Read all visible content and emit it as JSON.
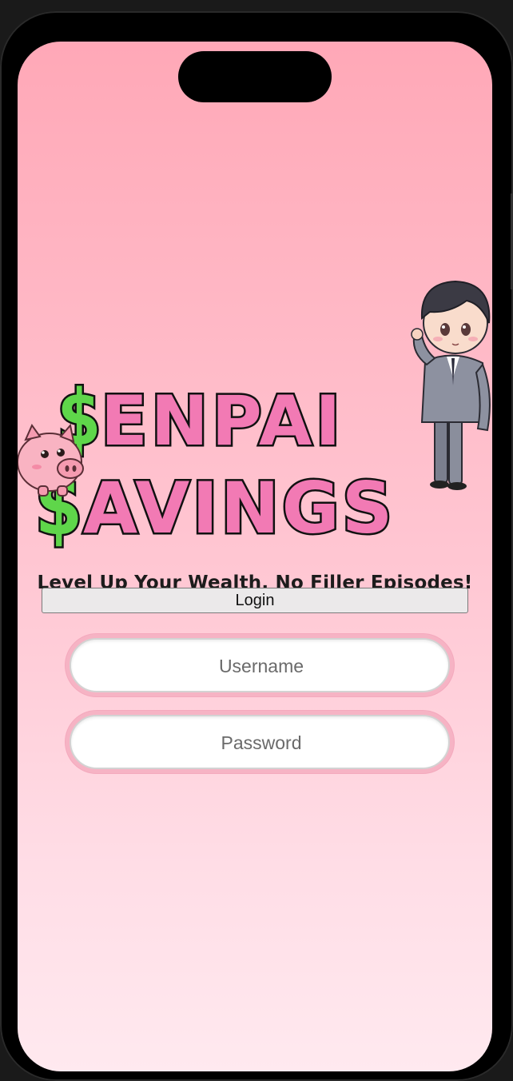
{
  "app": {
    "logo_text_line1": "SENPAI",
    "logo_text_line2": "SAVINGS",
    "tagline": "Level Up Your Wealth, No Filler Episodes!"
  },
  "auth": {
    "login_label": "Login",
    "username_placeholder": "Username",
    "password_placeholder": "Password",
    "username_value": "",
    "password_value": ""
  },
  "icons": {
    "piggy": "piggy-bank-mascot",
    "character": "chibi-businessman-mascot"
  },
  "colors": {
    "brand_pink": "#f27ab4",
    "brand_green": "#5fd64a",
    "bg_top": "#ffa8b7",
    "bg_bottom": "#ffe9ef"
  }
}
